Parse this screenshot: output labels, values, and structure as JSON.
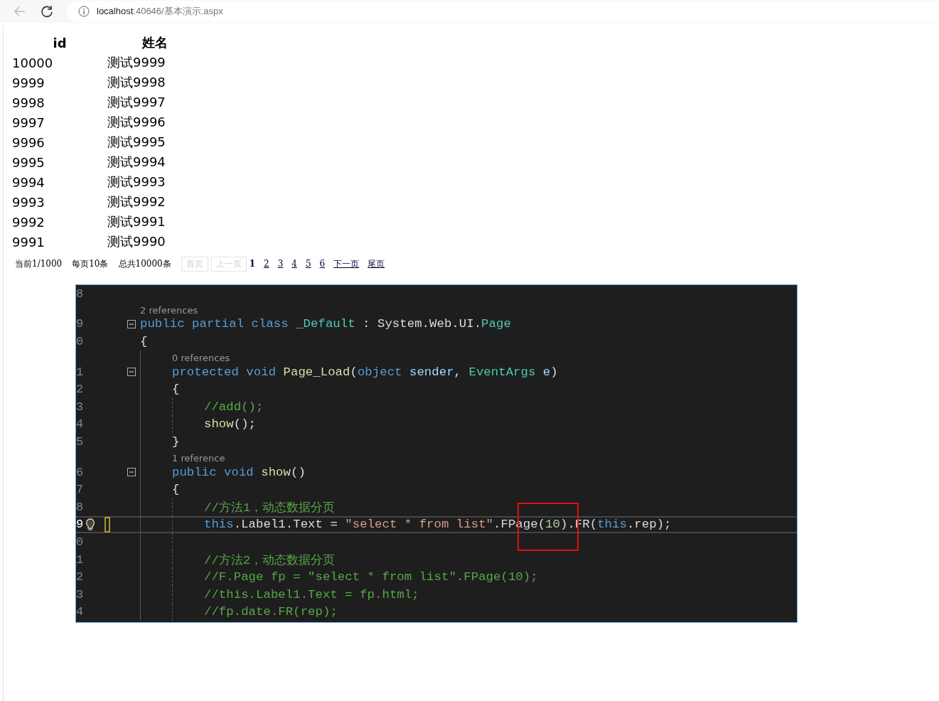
{
  "browser": {
    "url_host": "localhost",
    "url_rest": ":40646/基本演示.aspx"
  },
  "table": {
    "columns": [
      "id",
      "姓名"
    ],
    "rows": [
      [
        "10000",
        "测试9999"
      ],
      [
        "9999",
        "测试9998"
      ],
      [
        "9998",
        "测试9997"
      ],
      [
        "9997",
        "测试9996"
      ],
      [
        "9996",
        "测试9995"
      ],
      [
        "9995",
        "测试9994"
      ],
      [
        "9994",
        "测试9993"
      ],
      [
        "9993",
        "测试9992"
      ],
      [
        "9992",
        "测试9991"
      ],
      [
        "9991",
        "测试9990"
      ]
    ]
  },
  "pager": {
    "info": [
      "当前1/1000",
      "每页10条",
      "总共10000条"
    ],
    "links": [
      {
        "label": "首页",
        "disabled": true,
        "selected": false
      },
      {
        "label": "上一页",
        "disabled": true,
        "selected": false
      },
      {
        "label": "1",
        "disabled": false,
        "selected": true
      },
      {
        "label": "2",
        "disabled": false,
        "selected": false
      },
      {
        "label": "3",
        "disabled": false,
        "selected": false
      },
      {
        "label": "4",
        "disabled": false,
        "selected": false
      },
      {
        "label": "5",
        "disabled": false,
        "selected": false
      },
      {
        "label": "6",
        "disabled": false,
        "selected": false
      },
      {
        "label": "下一页",
        "disabled": false,
        "selected": false
      },
      {
        "label": "尾页",
        "disabled": false,
        "selected": false
      }
    ]
  },
  "code": {
    "lines": [
      {
        "num": "8",
        "fold": false,
        "current": false
      },
      {
        "num": "9",
        "lens": "2 references",
        "fold": true,
        "current": false,
        "tokens": [
          {
            "kind": "kw",
            "text": "public partial class "
          },
          {
            "kind": "type",
            "text": "_Default"
          },
          {
            "kind": "plain",
            "text": " : System.Web.UI."
          },
          {
            "kind": "type",
            "text": "Page"
          }
        ]
      },
      {
        "num": "0",
        "fold": false,
        "current": false,
        "tokens": [
          {
            "kind": "plain",
            "text": "{"
          }
        ]
      },
      {
        "children": [
          {
            "num": "1",
            "lens": "0 references",
            "fold": true,
            "current": false,
            "tokens": [
              {
                "kind": "kw",
                "text": "protected void "
              },
              {
                "kind": "method",
                "text": "Page_Load"
              },
              {
                "kind": "plain",
                "text": "("
              },
              {
                "kind": "kw",
                "text": "object "
              },
              {
                "kind": "param",
                "text": "sender"
              },
              {
                "kind": "plain",
                "text": ", "
              },
              {
                "kind": "type",
                "text": "EventArgs "
              },
              {
                "kind": "param",
                "text": "e"
              },
              {
                "kind": "plain",
                "text": ")"
              }
            ]
          },
          {
            "num": "2",
            "fold": false,
            "current": false,
            "tokens": [
              {
                "kind": "plain",
                "text": "{"
              }
            ]
          },
          {
            "children": [
              {
                "num": "3",
                "fold": false,
                "current": false,
                "tokens": [
                  {
                    "kind": "comment",
                    "text": "//add();"
                  }
                ]
              },
              {
                "num": "4",
                "fold": false,
                "current": false,
                "tokens": [
                  {
                    "kind": "method",
                    "text": "show"
                  },
                  {
                    "kind": "plain",
                    "text": "();"
                  }
                ]
              }
            ]
          },
          {
            "num": "5",
            "fold": false,
            "current": false,
            "tokens": [
              {
                "kind": "plain",
                "text": "}"
              }
            ]
          },
          {
            "num": "6",
            "lens": "1 reference",
            "fold": true,
            "current": false,
            "tokens": [
              {
                "kind": "kw",
                "text": "public void "
              },
              {
                "kind": "method",
                "text": "show"
              },
              {
                "kind": "plain",
                "text": "()"
              }
            ]
          },
          {
            "num": "7",
            "fold": false,
            "current": false,
            "tokens": [
              {
                "kind": "plain",
                "text": "{"
              }
            ]
          },
          {
            "children": [
              {
                "num": "8",
                "fold": false,
                "current": false,
                "tokens": [
                  {
                    "kind": "comment",
                    "text": "//方法1，动态数据分页"
                  }
                ]
              },
              {
                "num": "9",
                "fold": false,
                "current": true,
                "tokens": [
                  {
                    "kind": "kw",
                    "text": "this"
                  },
                  {
                    "kind": "plain",
                    "text": ".Label1.Text = "
                  },
                  {
                    "kind": "str",
                    "text": "\"select * from list\""
                  },
                  {
                    "kind": "plain",
                    "text": ".FPage("
                  },
                  {
                    "kind": "num",
                    "text": "10"
                  },
                  {
                    "kind": "plain",
                    "text": ").FR("
                  },
                  {
                    "kind": "kw",
                    "text": "this"
                  },
                  {
                    "kind": "plain",
                    "text": ".rep);"
                  }
                ]
              },
              {
                "num": "0",
                "fold": false,
                "current": false
              },
              {
                "num": "1",
                "fold": false,
                "current": false,
                "tokens": [
                  {
                    "kind": "comment",
                    "text": "//方法2，动态数据分页"
                  }
                ]
              },
              {
                "num": "2",
                "fold": false,
                "current": false,
                "tokens": [
                  {
                    "kind": "comment",
                    "text": "//F.Page fp = \"select * from list\".FPage(10);"
                  }
                ]
              },
              {
                "num": "3",
                "fold": false,
                "current": false,
                "tokens": [
                  {
                    "kind": "comment",
                    "text": "//this.Label1.Text = fp.html;"
                  }
                ]
              },
              {
                "num": "4",
                "fold": false,
                "current": false,
                "tokens": [
                  {
                    "kind": "comment",
                    "text": "//fp.date.FR(rep);"
                  }
                ]
              }
            ]
          }
        ]
      }
    ]
  }
}
